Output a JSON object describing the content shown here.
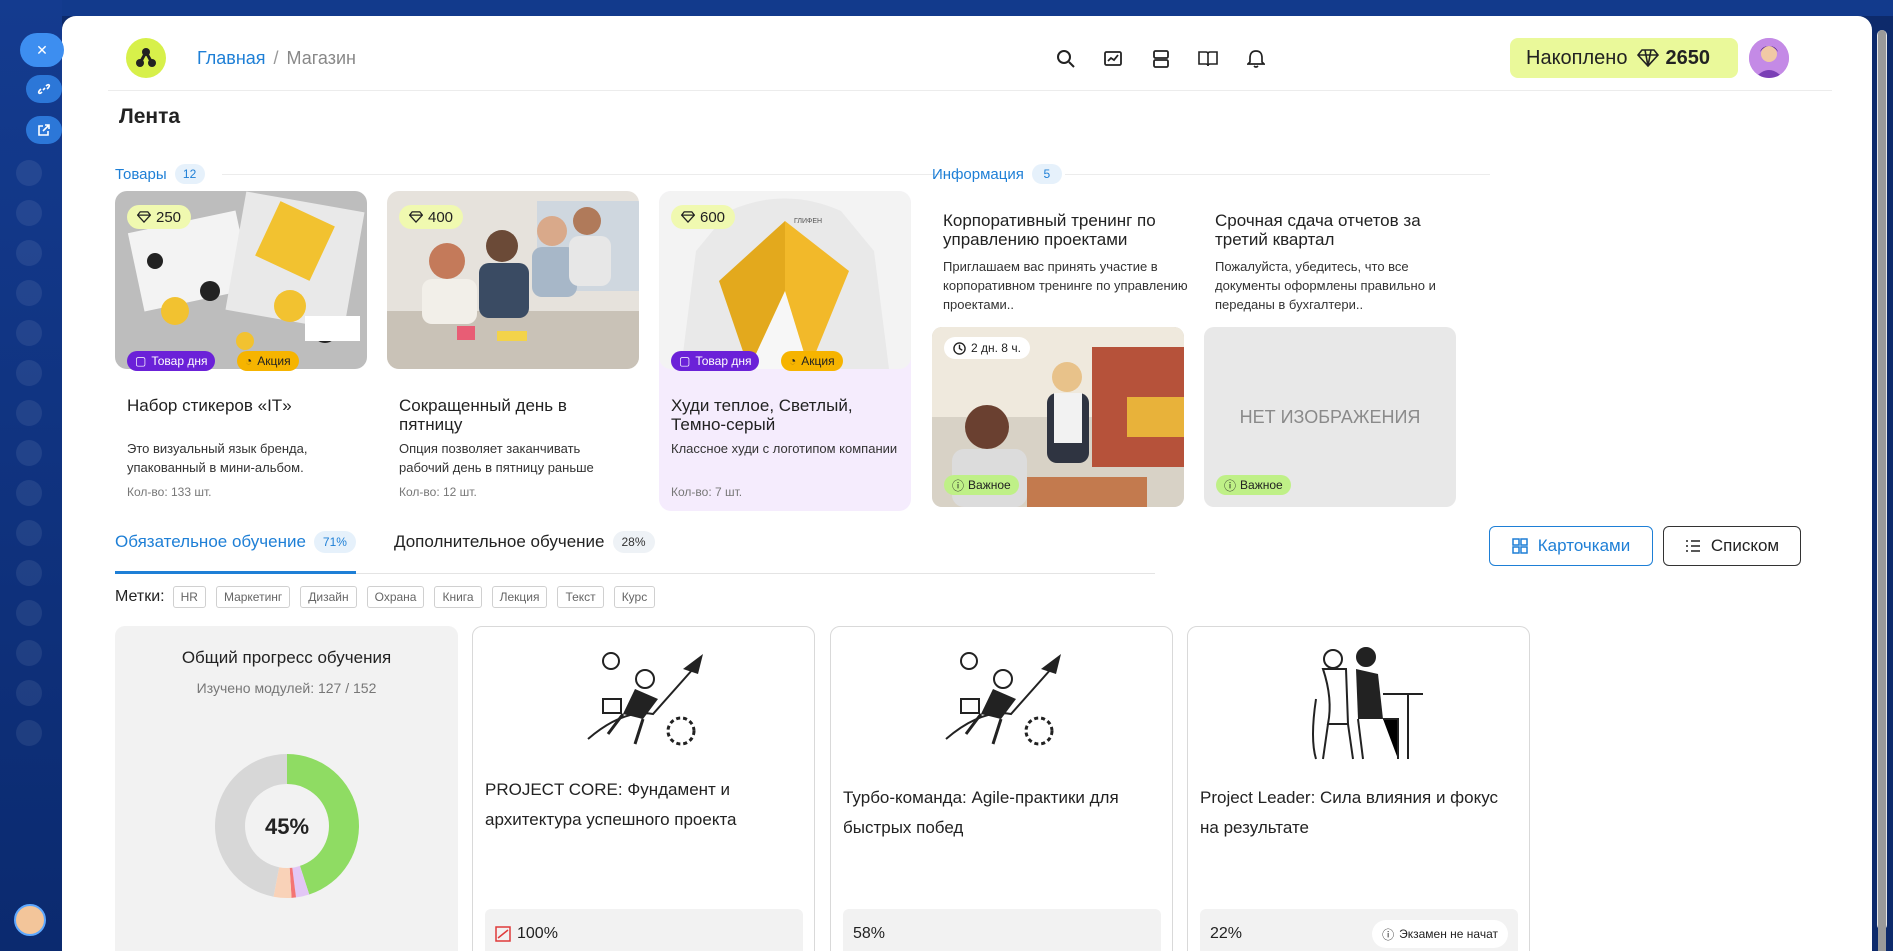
{
  "header": {
    "breadcrumb_home": "Главная",
    "breadcrumb_sep": "/",
    "breadcrumb_current": "Магазин",
    "accumulated_label": "Накоплено",
    "accumulated_value": "2650"
  },
  "page": {
    "title": "Лента"
  },
  "products_section": {
    "label": "Товары",
    "count": "12",
    "items": [
      {
        "price": "250",
        "badge_day": "Товар дня",
        "badge_sale": "Акция",
        "name": "Набор стикеров «IT»",
        "desc": "Это визуальный язык бренда, упакованный в мини-альбом.",
        "qty": "Кол-во: 133 шт."
      },
      {
        "price": "400",
        "name": "Сокращенный день в пятницу",
        "desc": "Опция позволяет заканчивать рабочий день в пятницу раньше",
        "qty": "Кол-во: 12 шт."
      },
      {
        "price": "600",
        "badge_day": "Товар дня",
        "badge_sale": "Акция",
        "name": "Худи теплое, Светлый, Темно-серый",
        "desc": "Классное худи с логотипом компании",
        "qty": "Кол-во: 7 шт."
      }
    ]
  },
  "info_section": {
    "label": "Информация",
    "count": "5",
    "items": [
      {
        "title": "Корпоративный тренинг по управлению проектами",
        "desc": "Приглашаем вас принять участие в корпоративном тренинге по управлению проектами..",
        "timer": "2 дн. 8 ч.",
        "badge": "Важное"
      },
      {
        "title": "Срочная сдача отчетов за третий квартал",
        "desc": "Пожалуйста, убедитесь, что все документы оформлены правильно и переданы в бухгалтери..",
        "no_image": "НЕТ ИЗОБРАЖЕНИЯ",
        "badge": "Важное"
      }
    ]
  },
  "tabs": [
    {
      "label": "Обязательное обучение",
      "pct": "71%"
    },
    {
      "label": "Дополнительное обучение",
      "pct": "28%"
    }
  ],
  "view_buttons": {
    "cards": "Карточками",
    "list": "Списком"
  },
  "tags": {
    "label": "Метки:",
    "items": [
      "HR",
      "Маркетинг",
      "Дизайн",
      "Охрана",
      "Книга",
      "Лекция",
      "Текст",
      "Курс"
    ]
  },
  "progress": {
    "title": "Общий прогресс обучения",
    "subtitle": "Изучено модулей: 127 / 152",
    "center": "45%",
    "value": 45
  },
  "courses": [
    {
      "title": "PROJECT CORE: Фундамент и архитектура успешного проекта",
      "progress": "100%"
    },
    {
      "title": "Турбо-команда: Agile-практики для быстрых побед",
      "progress": "58%"
    },
    {
      "title": "Project Leader: Сила влияния и фокус на результате",
      "progress": "22%",
      "exam": "Экзамен не начат"
    }
  ],
  "colors": {
    "accent": "#1e7fd6",
    "brand_lime": "#d7f04a",
    "badge_day": "#6b21d8",
    "badge_sale": "#f6b400",
    "important": "#bff087",
    "donut_done": "#8fdc63"
  }
}
